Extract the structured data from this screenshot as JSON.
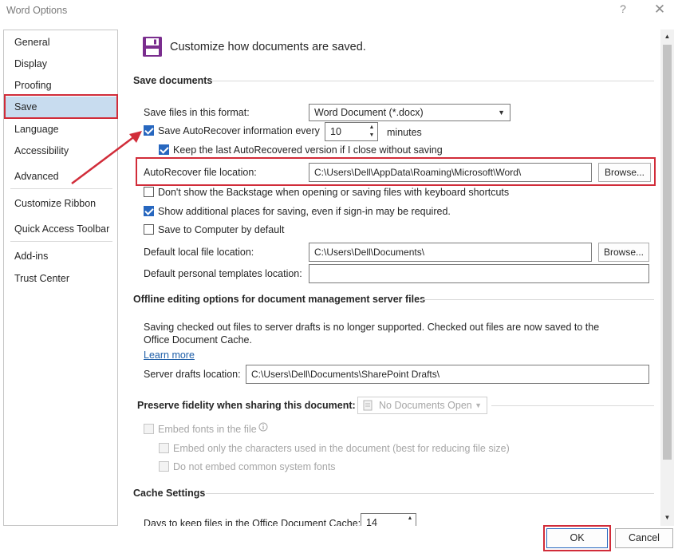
{
  "window": {
    "title": "Word Options",
    "help_label": "?",
    "close_label": "✕"
  },
  "sidebar": {
    "items": [
      {
        "label": "General"
      },
      {
        "label": "Display"
      },
      {
        "label": "Proofing"
      },
      {
        "label": "Save"
      },
      {
        "label": "Language"
      },
      {
        "label": "Accessibility"
      },
      {
        "label": "Advanced"
      },
      {
        "label": "Customize Ribbon"
      },
      {
        "label": "Quick Access Toolbar"
      },
      {
        "label": "Add-ins"
      },
      {
        "label": "Trust Center"
      }
    ],
    "selected": "Save"
  },
  "header": {
    "title": "Customize how documents are saved.",
    "icon": "floppy-disk-icon"
  },
  "save_documents": {
    "title": "Save documents",
    "format_label": "Save files in this format:",
    "format_value": "Word Document (*.docx)",
    "autorecover_label": "Save AutoRecover information every",
    "autorecover_checked": true,
    "autorecover_minutes": "10",
    "minutes_label": "minutes",
    "keep_last_label": "Keep the last AutoRecovered version if I close without saving",
    "keep_last_checked": true,
    "autorecover_location_label": "AutoRecover file location:",
    "autorecover_location_value": "C:\\Users\\Dell\\AppData\\Roaming\\Microsoft\\Word\\",
    "browse_label": "Browse...",
    "dont_show_backstage_label": "Don't show the Backstage when opening or saving files with keyboard shortcuts",
    "dont_show_backstage_checked": false,
    "show_additional_label": "Show additional places for saving, even if sign-in may be required.",
    "show_additional_checked": true,
    "save_to_computer_label": "Save to Computer by default",
    "save_to_computer_checked": false,
    "default_local_label": "Default local file location:",
    "default_local_value": "C:\\Users\\Dell\\Documents\\",
    "default_local_browse": "Browse...",
    "default_templates_label": "Default personal templates location:",
    "default_templates_value": ""
  },
  "offline": {
    "title": "Offline editing options for document management server files",
    "description": "Saving checked out files to server drafts is no longer supported. Checked out files are now saved to the Office Document Cache.",
    "learn_more": "Learn more",
    "server_drafts_label": "Server drafts location:",
    "server_drafts_value": "C:\\Users\\Dell\\Documents\\SharePoint Drafts\\"
  },
  "fidelity": {
    "title": "Preserve fidelity when sharing this document:",
    "document_value": "No Documents Open",
    "embed_fonts_label": "Embed fonts in the file",
    "embed_only_label": "Embed only the characters used in the document (best for reducing file size)",
    "do_not_embed_label": "Do not embed common system fonts"
  },
  "cache": {
    "title": "Cache Settings",
    "days_label": "Days to keep files in the Office Document Cache:",
    "days_value": "14"
  },
  "footer": {
    "ok_label": "OK",
    "cancel_label": "Cancel"
  },
  "colors": {
    "accent": "#2767bf",
    "annotation": "#d12c39",
    "selected_nav": "#c8dcef"
  }
}
